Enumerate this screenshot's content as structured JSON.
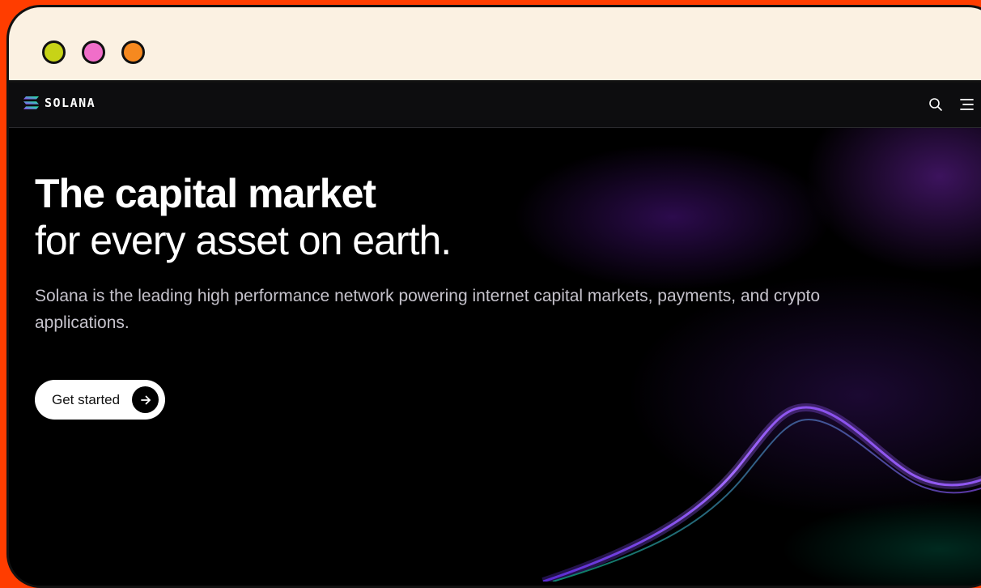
{
  "window": {
    "traffic_lights": [
      {
        "name": "yellow-green-dot",
        "color": "#c7d317"
      },
      {
        "name": "pink-dot",
        "color": "#f06ec9"
      },
      {
        "name": "orange-dot",
        "color": "#f6891f"
      }
    ]
  },
  "navbar": {
    "brand": "SOLANA",
    "icons": [
      "search-icon",
      "menu-icon"
    ]
  },
  "hero": {
    "headline_line1": "The capital market",
    "headline_line2": "for every asset on earth.",
    "subtitle": "Solana is the leading high performance network powering internet capital markets, payments, and crypto applications.",
    "cta_label": "Get started"
  },
  "colors": {
    "page_background": "#ff3d00",
    "titlebar": "#fbf1e2",
    "hero_background": "#000000",
    "brand_gradient": [
      "#9945ff",
      "#14f195"
    ]
  }
}
